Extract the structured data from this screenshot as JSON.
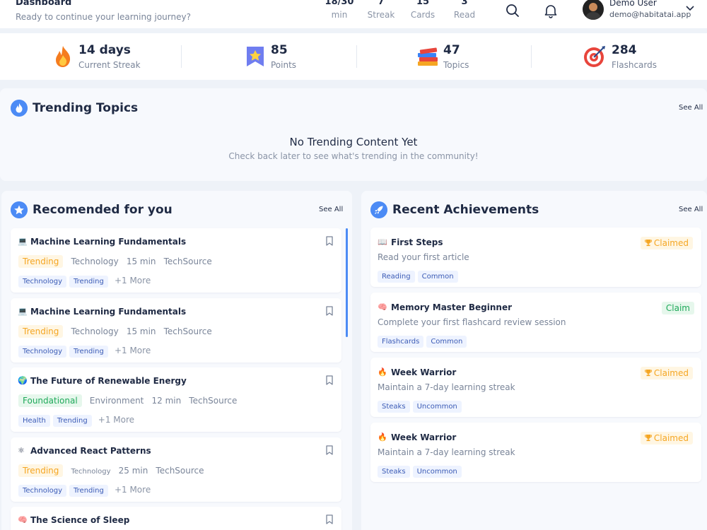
{
  "header": {
    "title": "Dashboard",
    "subtitle": "Ready to continue your learning journey?",
    "stats": [
      {
        "value": "18/30",
        "label": "min"
      },
      {
        "value": "7",
        "label": "Streak"
      },
      {
        "value": "15",
        "label": "Cards"
      },
      {
        "value": "3",
        "label": "Read"
      }
    ],
    "user_name": "Demo User",
    "user_email": "demo@habitatai.app"
  },
  "stats": [
    {
      "value": "14 days",
      "label": "Current Streak",
      "icon": "fire-icon"
    },
    {
      "value": "85",
      "label": "Points",
      "icon": "star-badge-icon"
    },
    {
      "value": "47",
      "label": "Topics",
      "icon": "books-icon"
    },
    {
      "value": "284",
      "label": "Flashcards",
      "icon": "target-icon"
    }
  ],
  "trending": {
    "title": "Trending Topics",
    "see_all": "See All",
    "empty_title": "No Trending Content Yet",
    "empty_subtitle": "Check back later to see what's trending in the community!"
  },
  "recommended": {
    "title": "Recomended for you",
    "see_all": "See All",
    "items": [
      {
        "icon": "💻",
        "title": "Machine Learning Fundamentals",
        "badge": "Trending",
        "badge_color": "#f5a623",
        "category": "Technology",
        "duration": "15 min",
        "source": "TechSource",
        "tags": [
          "Technology",
          "Trending"
        ],
        "more": "+1 More"
      },
      {
        "icon": "💻",
        "title": "Machine Learning Fundamentals",
        "badge": "Trending",
        "badge_color": "#f5a623",
        "category": "Technology",
        "duration": "15 min",
        "source": "TechSource",
        "tags": [
          "Technology",
          "Trending"
        ],
        "more": "+1 More"
      },
      {
        "icon": "🌍",
        "title": "The Future of Renewable Energy",
        "badge": "Foundational",
        "badge_color": "#1fa95a",
        "category": "Environment",
        "duration": "12 min",
        "source": "TechSource",
        "tags": [
          "Health",
          "Trending"
        ],
        "more": "+1 More"
      },
      {
        "icon": "⚛",
        "title": "Advanced React Patterns",
        "badge": "Trending",
        "badge_color": "#f5a623",
        "category": "Technology",
        "duration": "25 min",
        "source": "TechSource",
        "tags": [
          "Technology",
          "Trending"
        ],
        "more": "+1 More"
      },
      {
        "icon": "🧠",
        "title": "The Science of Sleep",
        "badge": "",
        "badge_color": "#f5a623",
        "category": "",
        "duration": "",
        "source": "",
        "tags": [],
        "more": ""
      }
    ]
  },
  "achievements": {
    "title": "Recent Achievements",
    "see_all": "See All",
    "items": [
      {
        "icon": "📖",
        "title": "First Steps",
        "desc": "Read your first article",
        "tags": [
          "Reading",
          "Common"
        ],
        "status": "Claimed",
        "status_kind": "claimed"
      },
      {
        "icon": "🧠",
        "title": "Memory Master Beginner",
        "desc": "Complete your first flashcard review session",
        "tags": [
          "Flashcards",
          "Common"
        ],
        "status": "Claim",
        "status_kind": "claim"
      },
      {
        "icon": "🔥",
        "title": "Week Warrior",
        "desc": "Maintain a 7-day learning streak",
        "tags": [
          "Steaks",
          "Uncommon"
        ],
        "status": "Claimed",
        "status_kind": "claimed"
      },
      {
        "icon": "🔥",
        "title": "Week Warrior",
        "desc": "Maintain a 7-day learning streak",
        "tags": [
          "Steaks",
          "Uncommon"
        ],
        "status": "Claimed",
        "status_kind": "claimed"
      }
    ]
  },
  "colors": {
    "accent": "#4c8bf5",
    "trending": "#f5a623",
    "foundational": "#1fa95a",
    "claimed": "#f5a623",
    "claim": "#1fa95a"
  }
}
